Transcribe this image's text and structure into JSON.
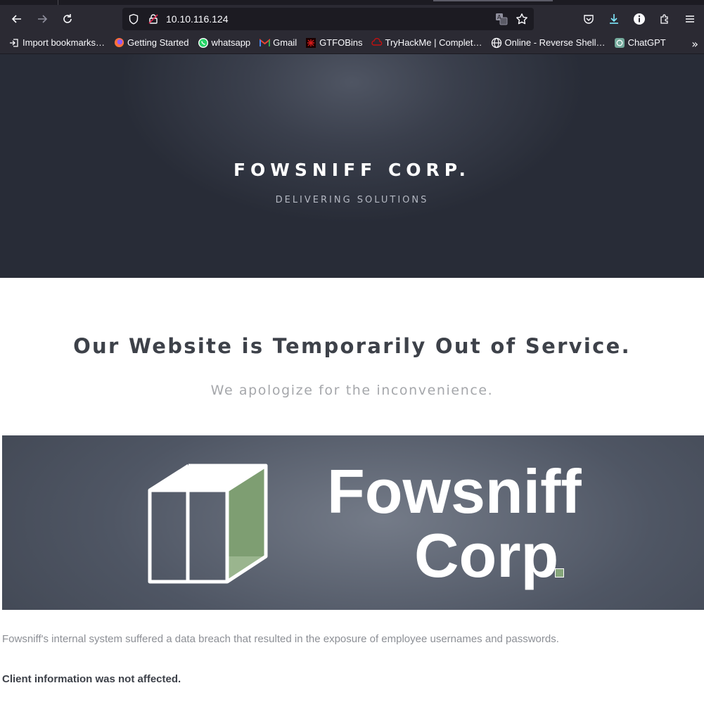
{
  "browser": {
    "url": "10.10.116.124",
    "bookmarks": [
      {
        "label": "Import bookmarks…",
        "icon": "import-icon"
      },
      {
        "label": "Getting Started",
        "icon": "firefox-icon"
      },
      {
        "label": "whatsapp",
        "icon": "whatsapp-icon"
      },
      {
        "label": "Gmail",
        "icon": "gmail-icon"
      },
      {
        "label": "GTFOBins",
        "icon": "gtfobins-icon"
      },
      {
        "label": "TryHackMe | Complet…",
        "icon": "tryhackme-icon"
      },
      {
        "label": "Online - Reverse Shell…",
        "icon": "globe-icon"
      },
      {
        "label": "ChatGPT",
        "icon": "chatgpt-icon"
      }
    ],
    "overflow_label": "»"
  },
  "hero": {
    "title": "FOWSNIFF CORP.",
    "subtitle": "DELIVERING SOLUTIONS"
  },
  "notice": {
    "title": "Our Website is Temporarily Out of Service.",
    "subtitle": "We apologize for the inconvenience."
  },
  "banner": {
    "line1": "Fowsniff",
    "line2": "Corp"
  },
  "body": {
    "paragraph": "Fowsniff's internal system suffered a data breach that resulted in the exposure of employee usernames and passwords.",
    "bold": "Client information was not affected."
  },
  "colors": {
    "chrome_bg": "#2b2a33",
    "urlbar_bg": "#1c1b22",
    "hero_bg": "#2f3440",
    "accent_green": "#86a67b"
  }
}
